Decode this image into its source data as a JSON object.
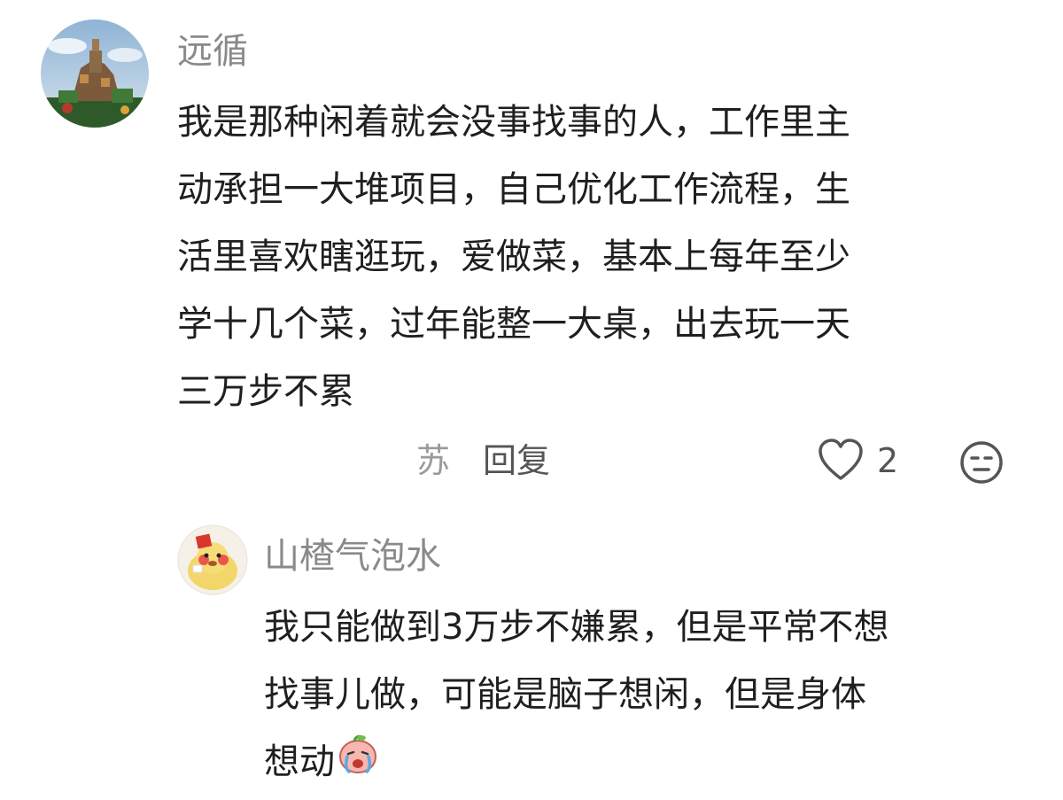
{
  "comments": [
    {
      "username": "远循",
      "lines": [
        "我是那种闲着就会没事找事的人，工作里主",
        "动承担一大堆项目，自己优化工作流程，生",
        "活里喜欢瞎逛玩，爱做菜，基本上每年至少",
        "学十几个菜，过年能整一大桌，出去玩一天",
        "三万步不累"
      ],
      "location": "苏",
      "reply_label": "回复",
      "like_count": "2",
      "like_icon": "heart-outline-icon",
      "dislike_icon": "unamused-face-icon"
    },
    {
      "username": "山楂气泡水",
      "lines": [
        "我只能做到3万步不嫌累，但是平常不想",
        "找事儿做，可能是脑子想闲，但是身体",
        "想动"
      ],
      "trailing_emoji": "crying-peach-emoji"
    }
  ],
  "colors": {
    "username": "#8a8a8a",
    "body": "#1f1f1f",
    "meta": "#9a9a9a",
    "icon": "#555555"
  }
}
